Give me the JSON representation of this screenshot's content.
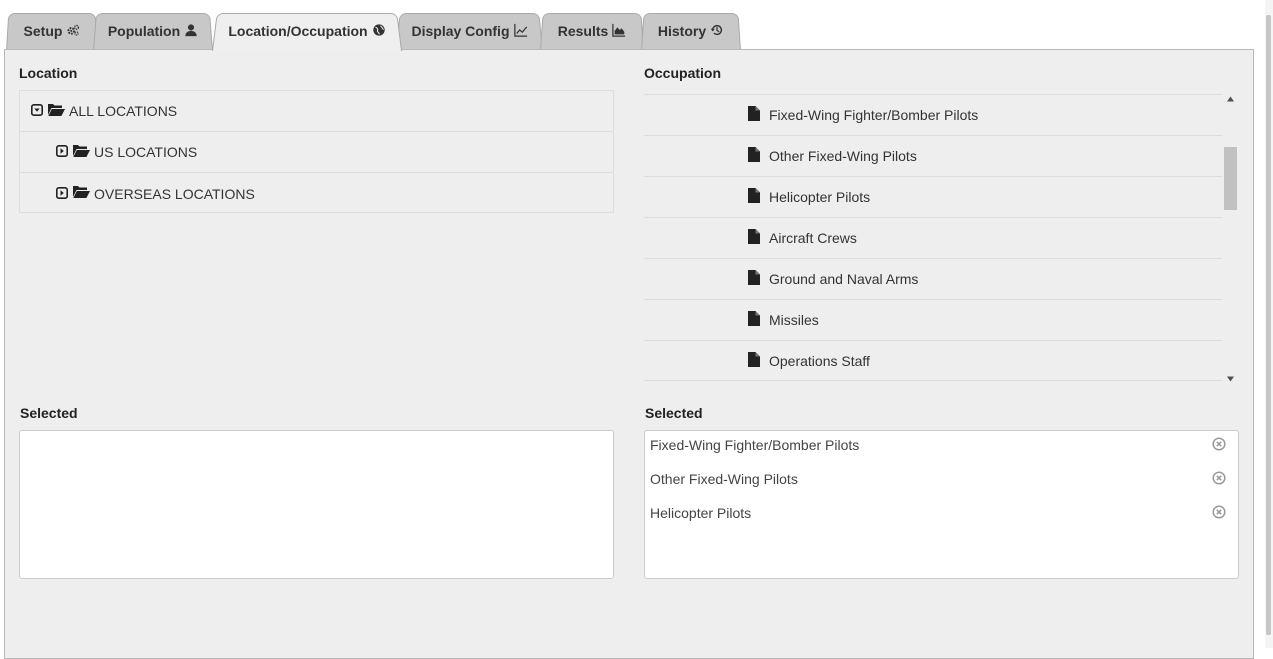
{
  "tabs": [
    {
      "label": "Setup",
      "icon": "gears-icon"
    },
    {
      "label": "Population",
      "icon": "user-icon"
    },
    {
      "label": "Location/Occupation",
      "icon": "globe-icon",
      "active": true
    },
    {
      "label": "Display Config",
      "icon": "line-chart-icon"
    },
    {
      "label": "Results",
      "icon": "area-chart-icon"
    },
    {
      "label": "History",
      "icon": "history-icon"
    }
  ],
  "location": {
    "heading": "Location",
    "tree": [
      {
        "label": "ALL LOCATIONS",
        "state": "expanded"
      },
      {
        "label": "US LOCATIONS",
        "state": "collapsed"
      },
      {
        "label": "OVERSEAS LOCATIONS",
        "state": "collapsed"
      }
    ],
    "selected_heading": "Selected",
    "selected": []
  },
  "occupation": {
    "heading": "Occupation",
    "items": [
      "Fixed-Wing Fighter/Bomber Pilots",
      "Other Fixed-Wing Pilots",
      "Helicopter Pilots",
      "Aircraft Crews",
      "Ground and Naval Arms",
      "Missiles",
      "Operations Staff"
    ],
    "selected_heading": "Selected",
    "selected": [
      "Fixed-Wing Fighter/Bomber Pilots",
      "Other Fixed-Wing Pilots",
      "Helicopter Pilots"
    ]
  }
}
